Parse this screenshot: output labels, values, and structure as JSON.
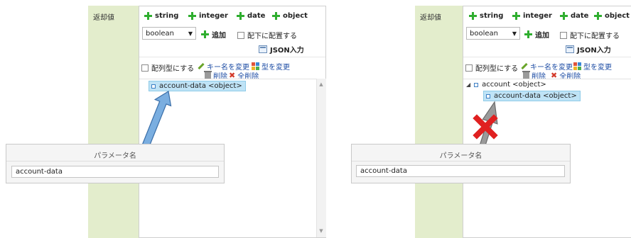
{
  "panels": [
    {
      "id": "left",
      "return_value_label": "返却値",
      "type_buttons": [
        "string",
        "integer",
        "date",
        "object"
      ],
      "type_select": "boolean",
      "add_label": "追加",
      "place_below_label": "配下に配置する",
      "json_input_label": "JSON入力",
      "array_label": "配列型にする",
      "rename_key_label": "キー名を変更",
      "change_type_label": "型を変更",
      "delete_label": "削除",
      "delete_all_label": "全削除",
      "tree_root": "account-data <object>",
      "param_title": "パラメータ名",
      "param_value": "account-data"
    },
    {
      "id": "right",
      "return_value_label": "返却値",
      "type_buttons": [
        "string",
        "integer",
        "date",
        "object"
      ],
      "type_select": "boolean",
      "add_label": "追加",
      "place_below_label": "配下に配置する",
      "json_input_label": "JSON入力",
      "array_label": "配列型にする",
      "rename_key_label": "キー名を変更",
      "change_type_label": "型を変更",
      "delete_label": "削除",
      "delete_all_label": "全削除",
      "tree_root": "account <object>",
      "tree_child": "account-data <object>",
      "param_title": "パラメータ名",
      "param_value": "account-data"
    }
  ],
  "colors": {
    "green_column": "#e3edcc",
    "plus_icon": "#2fae2f",
    "link": "#1f4ea5",
    "selected_row": "#bfe3f6",
    "arrow_ok": "#7aaee0",
    "arrow_ng": "#9a9a9a",
    "cross": "#e02020"
  }
}
